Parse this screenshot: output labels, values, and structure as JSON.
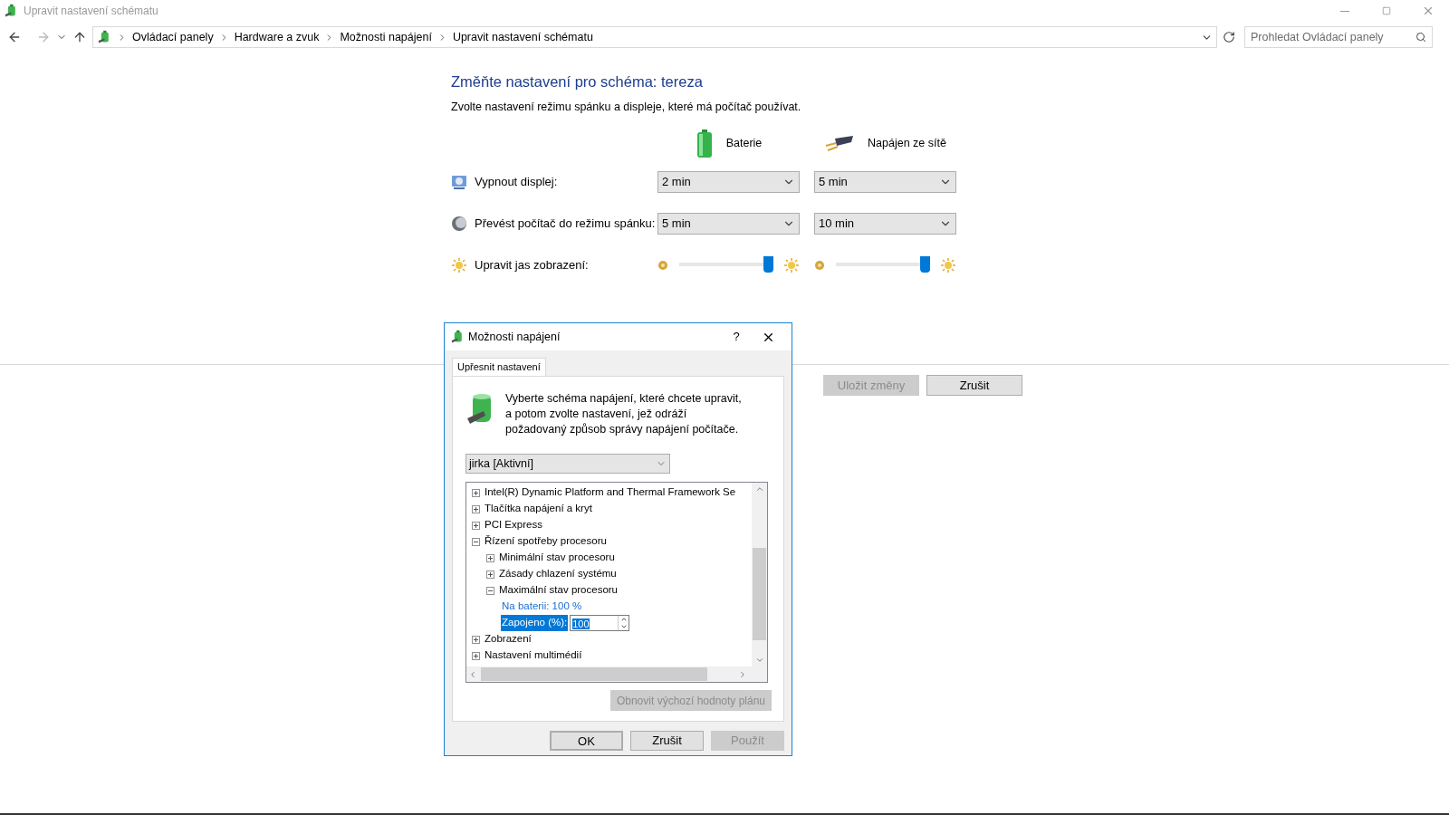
{
  "window": {
    "title": "Upravit nastavení schématu"
  },
  "breadcrumb": [
    "Ovládací panely",
    "Hardware a zvuk",
    "Možnosti napájení",
    "Upravit nastavení schématu"
  ],
  "search": {
    "placeholder": "Prohledat Ovládací panely"
  },
  "heading": "Změňte nastavení pro schéma: tereza",
  "subtitle": "Zvolte nastavení režimu spánku a displeje, které má počítač používat.",
  "columns": [
    "Baterie",
    "Napájen ze sítě"
  ],
  "settings": [
    {
      "kind": "dropdown",
      "label": "Vypnout displej:",
      "values": [
        "2 min",
        "5 min"
      ]
    },
    {
      "kind": "dropdown",
      "label": "Převést počítač do režimu spánku:",
      "values": [
        "5 min",
        "10 min"
      ]
    },
    {
      "kind": "slider",
      "label": "Upravit jas zobrazení:",
      "sliders": [
        {
          "level": 0.95
        },
        {
          "level": 0.95
        }
      ]
    }
  ],
  "buttons": [
    {
      "label": "Uložit změny",
      "disabled": true
    },
    {
      "label": "Zrušit",
      "disabled": false
    }
  ],
  "dialog": {
    "title": "Možnosti napájení",
    "help": "?",
    "tabs": [
      {
        "label": "Upřesnit nastavení",
        "selected": true
      }
    ],
    "description": "Vyberte schéma napájení, které chcete upravit, a potom zvolte nastavení, jež odráží požadovaný způsob správy napájení počítače.",
    "plan": "jirka [Aktivní]",
    "tree": [
      {
        "kind": "group",
        "label": "Intel(R) Dynamic Platform and Thermal Framework Se",
        "expanded": false
      },
      {
        "kind": "group",
        "label": "Tlačítka napájení a kryt",
        "expanded": false
      },
      {
        "kind": "group",
        "label": "PCI Express",
        "expanded": false
      },
      {
        "kind": "group",
        "label": "Řízení spotřeby procesoru",
        "expanded": true,
        "children": [
          {
            "kind": "group",
            "label": "Minimální stav procesoru",
            "expanded": false
          },
          {
            "kind": "group",
            "label": "Zásady chlazení systému",
            "expanded": false
          },
          {
            "kind": "group",
            "label": "Maximální stav procesoru",
            "expanded": true,
            "children": [
              {
                "kind": "value",
                "label": "Na baterii: 100 %",
                "selected": false
              },
              {
                "kind": "spin",
                "label": "Zapojeno (%):",
                "value": "100",
                "selected": true
              }
            ]
          }
        ]
      },
      {
        "kind": "group",
        "label": "Zobrazení",
        "expanded": false
      },
      {
        "kind": "group",
        "label": "Nastavení multimédií",
        "expanded": false
      }
    ],
    "reset_button": {
      "label": "Obnovit výchozí hodnoty plánu",
      "disabled": true
    },
    "buttons": [
      {
        "label": "OK",
        "disabled": false,
        "default": true
      },
      {
        "label": "Zrušit",
        "disabled": false,
        "default": false
      },
      {
        "label": "Použít",
        "disabled": true,
        "default": false
      }
    ]
  }
}
